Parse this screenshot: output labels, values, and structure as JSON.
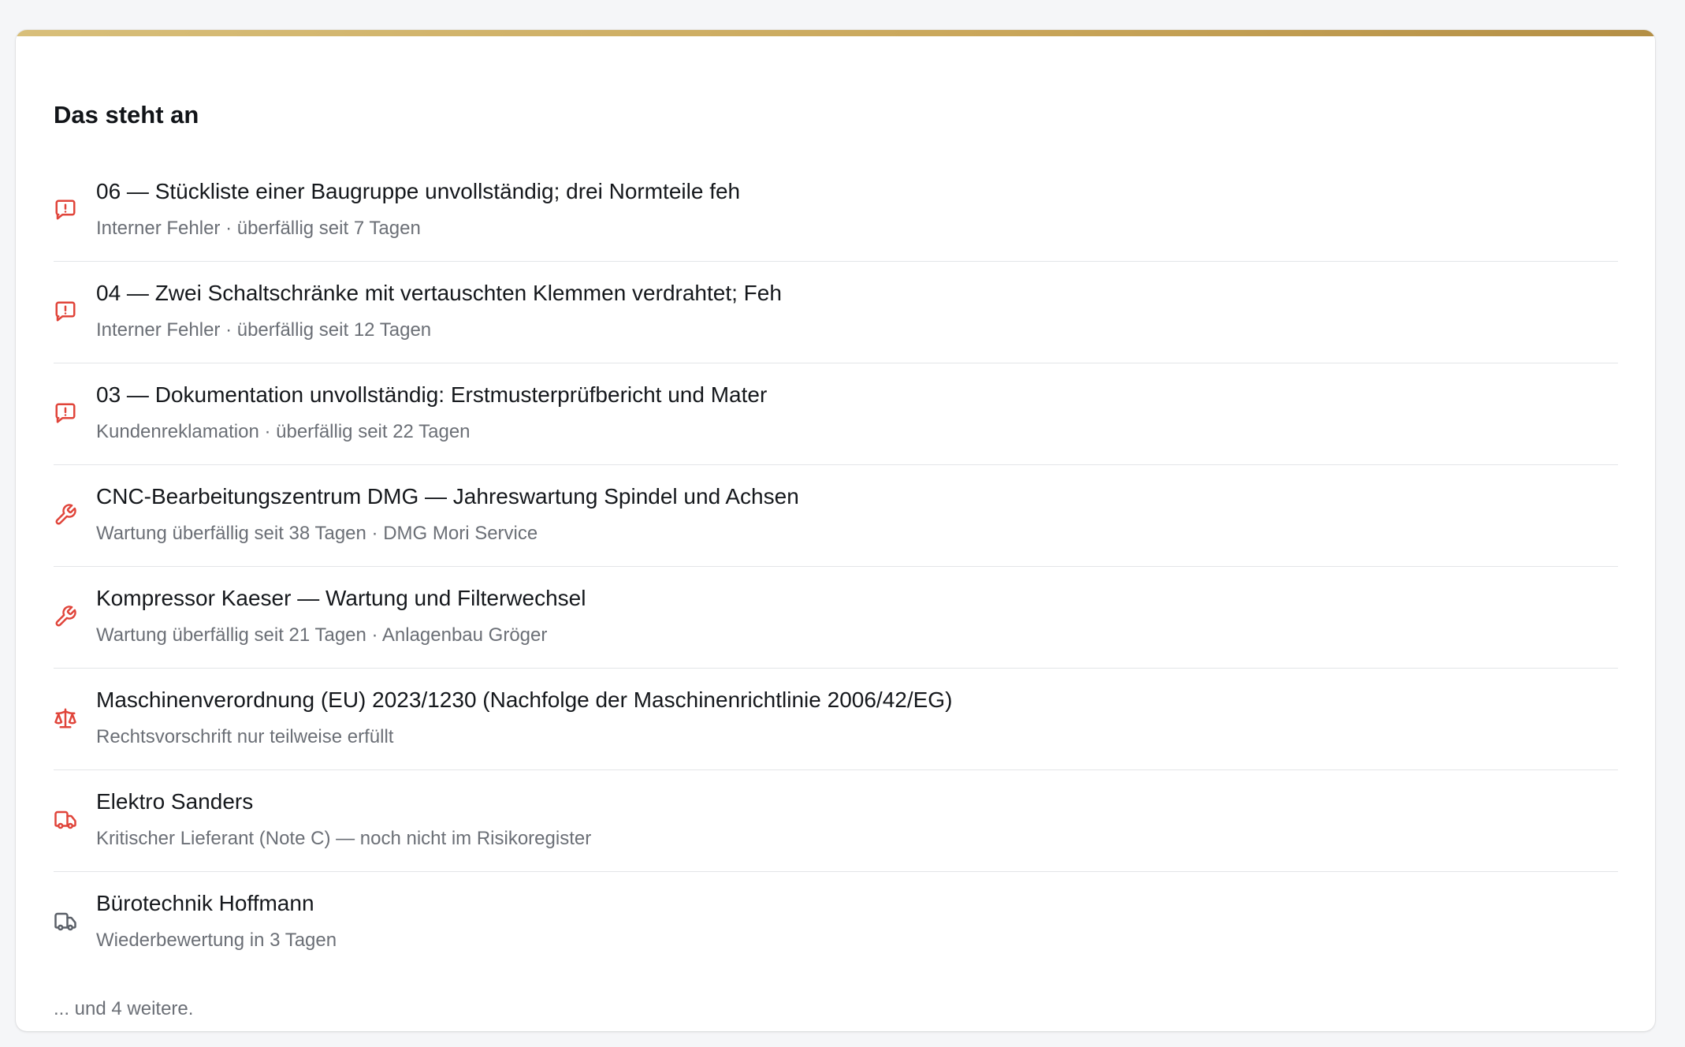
{
  "panel": {
    "title": "Das steht an",
    "more_text": "... und 4 weitere."
  },
  "colors": {
    "accent_gold": "#c9a65a",
    "alert_red": "#e0443a",
    "neutral_icon": "#5b6068"
  },
  "items": [
    {
      "icon": "alert-message-icon",
      "title": "06 — Stückliste einer Baugruppe unvollständig; drei Normteile feh",
      "subtitle": "Interner Fehler · überfällig seit 7 Tagen"
    },
    {
      "icon": "alert-message-icon",
      "title": "04 — Zwei Schaltschränke mit vertauschten Klemmen verdrahtet; Feh",
      "subtitle": "Interner Fehler · überfällig seit 12 Tagen"
    },
    {
      "icon": "alert-message-icon",
      "title": "03 — Dokumentation unvollständig: Erstmusterprüfbericht und Mater",
      "subtitle": "Kundenreklamation · überfällig seit 22 Tagen"
    },
    {
      "icon": "wrench-icon",
      "title": "CNC-Bearbeitungszentrum DMG — Jahreswartung Spindel und Achsen",
      "subtitle": "Wartung überfällig seit 38 Tagen · DMG Mori Service"
    },
    {
      "icon": "wrench-icon",
      "title": "Kompressor Kaeser — Wartung und Filterwechsel",
      "subtitle": "Wartung überfällig seit 21 Tagen · Anlagenbau Gröger"
    },
    {
      "icon": "scale-icon",
      "title": "Maschinenverordnung (EU) 2023/1230 (Nachfolge der Maschinenrichtlinie 2006/42/EG)",
      "subtitle": "Rechtsvorschrift nur teilweise erfüllt"
    },
    {
      "icon": "truck-icon",
      "title": "Elektro Sanders",
      "subtitle": "Kritischer Lieferant (Note C) — noch nicht im Risikoregister"
    },
    {
      "icon": "truck-icon",
      "title": "Bürotechnik Hoffmann",
      "subtitle": "Wiederbewertung in 3 Tagen"
    }
  ]
}
